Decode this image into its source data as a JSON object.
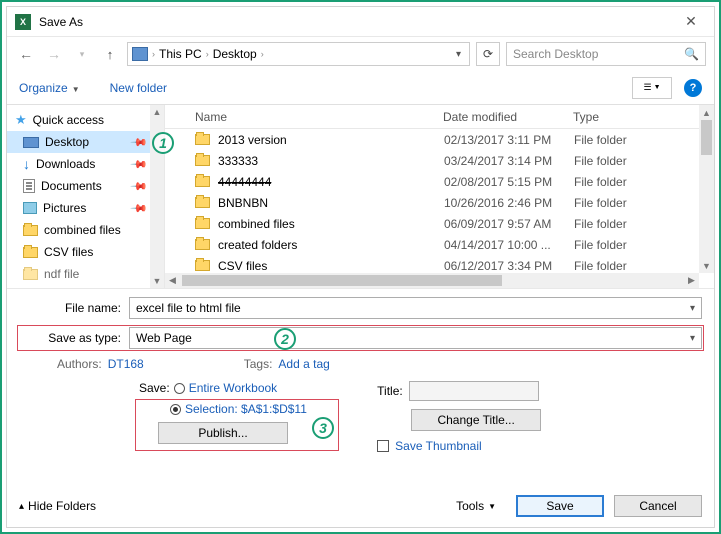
{
  "title": "Save As",
  "breadcrumb": {
    "pc": "This PC",
    "loc": "Desktop"
  },
  "search": {
    "placeholder": "Search Desktop"
  },
  "toolbar": {
    "organize": "Organize",
    "newfolder": "New folder"
  },
  "sidebar": {
    "quick": "Quick access",
    "desktop": "Desktop",
    "downloads": "Downloads",
    "documents": "Documents",
    "pictures": "Pictures",
    "combined": "combined files",
    "csv": "CSV files",
    "pdf": "ndf file"
  },
  "cols": {
    "name": "Name",
    "date": "Date modified",
    "type": "Type"
  },
  "files": [
    {
      "name": "2013 version",
      "date": "02/13/2017 3:11 PM",
      "type": "File folder"
    },
    {
      "name": "333333",
      "date": "03/24/2017 3:14 PM",
      "type": "File folder"
    },
    {
      "name": "44444444",
      "date": "02/08/2017 5:15 PM",
      "type": "File folder",
      "strike": true
    },
    {
      "name": "BNBNBN",
      "date": "10/26/2016 2:46 PM",
      "type": "File folder"
    },
    {
      "name": "combined files",
      "date": "06/09/2017 9:57 AM",
      "type": "File folder"
    },
    {
      "name": "created folders",
      "date": "04/14/2017 10:00 ...",
      "type": "File folder"
    },
    {
      "name": "CSV files",
      "date": "06/12/2017 3:34 PM",
      "type": "File folder"
    }
  ],
  "fields": {
    "filename_label": "File name:",
    "filename_value": "excel file to html file",
    "type_label": "Save as type:",
    "type_value": "Web Page",
    "authors_label": "Authors:",
    "authors_value": "DT168",
    "tags_label": "Tags:",
    "tags_value": "Add a tag"
  },
  "save_opts": {
    "label": "Save:",
    "entire": "Entire Workbook",
    "selection": "Selection: $A$1:$D$11",
    "publish": "Publish..."
  },
  "title_opts": {
    "label": "Title:",
    "change": "Change Title...",
    "thumb": "Save Thumbnail"
  },
  "footer": {
    "hide": "Hide Folders",
    "tools": "Tools",
    "save": "Save",
    "cancel": "Cancel"
  },
  "callouts": {
    "c1": "1",
    "c2": "2",
    "c3": "3"
  }
}
